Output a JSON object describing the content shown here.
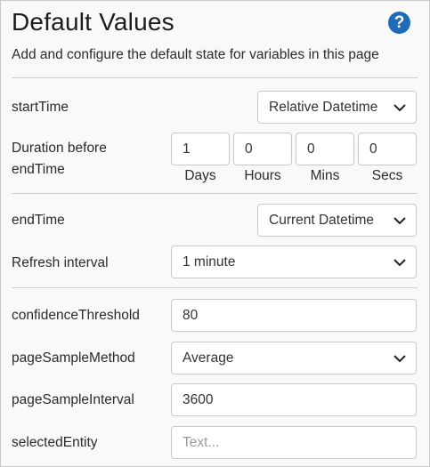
{
  "header": {
    "title": "Default Values",
    "help_icon": "?",
    "subtitle": "Add and configure the default state for variables in this page"
  },
  "start_time": {
    "label": "startTime",
    "value": "Relative Datetime"
  },
  "duration": {
    "label_line1": "Duration before",
    "label_line2": "endTime",
    "fields": [
      {
        "value": "1",
        "unit": "Days"
      },
      {
        "value": "0",
        "unit": "Hours"
      },
      {
        "value": "0",
        "unit": "Mins"
      },
      {
        "value": "0",
        "unit": "Secs"
      }
    ]
  },
  "end_time": {
    "label": "endTime",
    "value": "Current Datetime"
  },
  "refresh": {
    "label": "Refresh interval",
    "value": "1 minute"
  },
  "confidence": {
    "label": "confidenceThreshold",
    "value": "80"
  },
  "sample_method": {
    "label": "pageSampleMethod",
    "value": "Average"
  },
  "sample_interval": {
    "label": "pageSampleInterval",
    "value": "3600"
  },
  "selected_entity": {
    "label": "selectedEntity",
    "value": "",
    "placeholder": "Text..."
  },
  "icons": {
    "help": "question-circle-icon",
    "dropdown": "chevron-down-icon"
  },
  "colors": {
    "accent": "#1e6bb8",
    "panel_bg": "#f9f9f9",
    "border": "#c8c8c8"
  }
}
